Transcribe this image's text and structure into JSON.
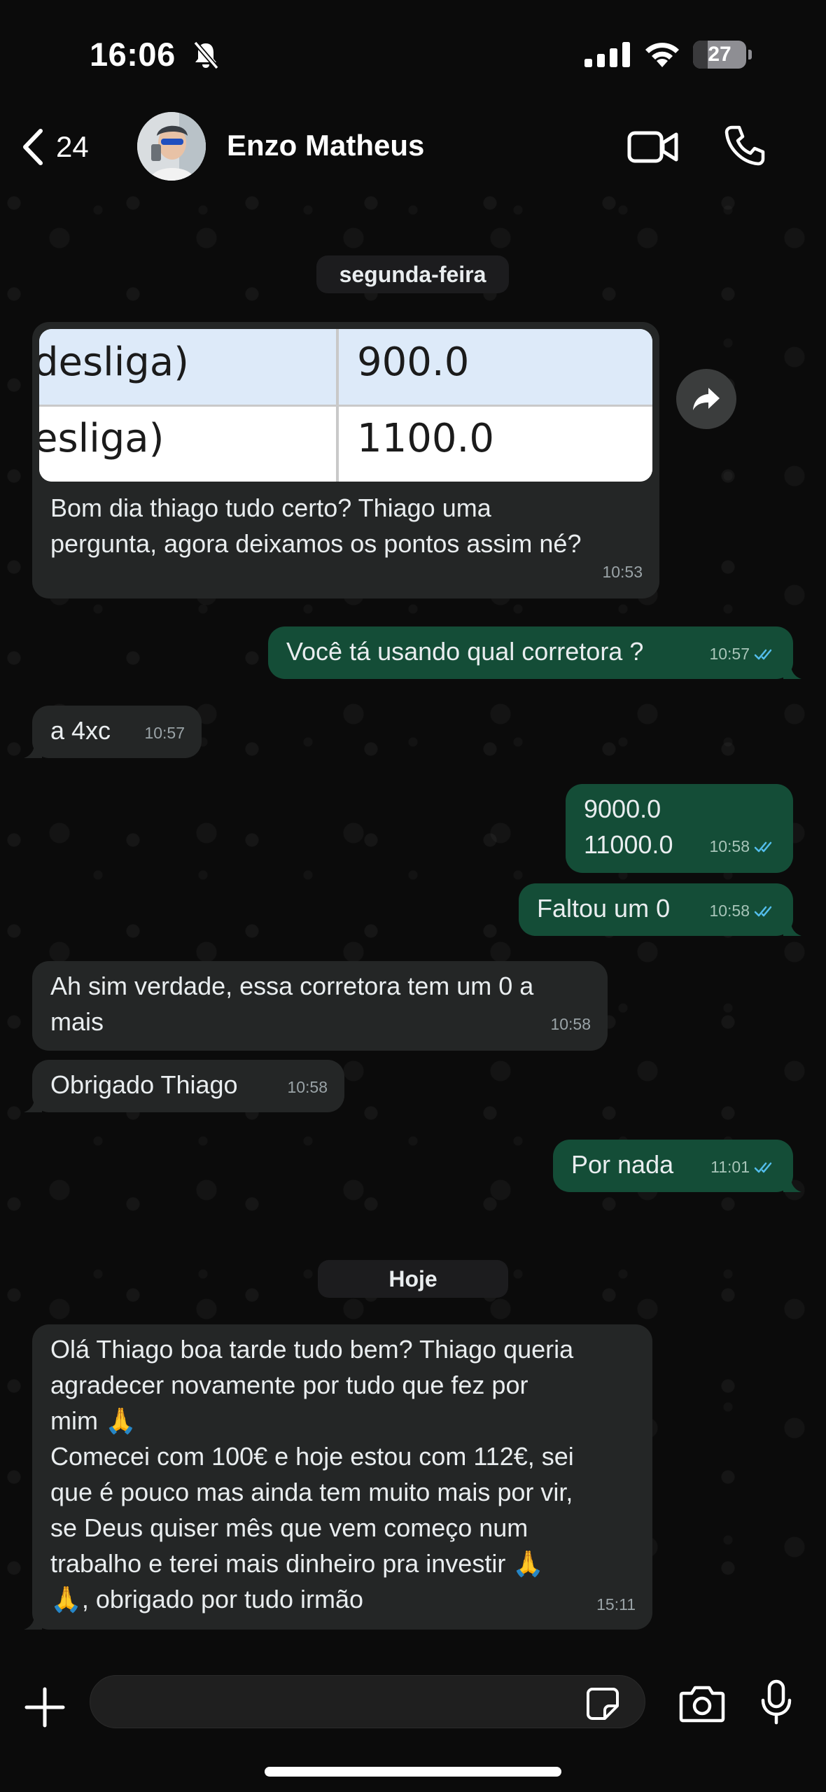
{
  "status_bar": {
    "time": "16:06",
    "battery": "27",
    "battery_level": 0.27
  },
  "header": {
    "back_count": "24",
    "contact_name": "Enzo Matheus"
  },
  "date_chips": {
    "monday": "segunda-feira",
    "today": "Hoje"
  },
  "table_image": {
    "rows": [
      {
        "left": "desliga)",
        "right": "900.0"
      },
      {
        "left": "esliga)",
        "right": "1100.0"
      }
    ]
  },
  "messages": [
    {
      "direction": "in",
      "text": "Bom dia thiago tudo certo? Thiago uma\npergunta, agora deixamos os pontos assim né?",
      "time": "10:53"
    },
    {
      "direction": "out",
      "text": "Você tá usando qual corretora ?",
      "time": "10:57"
    },
    {
      "direction": "in",
      "text": "a 4xc",
      "time": "10:57"
    },
    {
      "direction": "out",
      "text": "9000.0\n11000.0",
      "time": "10:58"
    },
    {
      "direction": "out",
      "text": "Faltou um 0",
      "time": "10:58"
    },
    {
      "direction": "in",
      "text": "Ah sim verdade, essa corretora tem um 0 a\nmais",
      "time": "10:58"
    },
    {
      "direction": "in",
      "text": "Obrigado Thiago",
      "time": "10:58"
    },
    {
      "direction": "out",
      "text": "Por nada",
      "time": "11:01"
    },
    {
      "direction": "in",
      "text": "Olá Thiago boa tarde tudo bem? Thiago queria\nagradecer novamente por tudo que fez por\nmim 🙏\nComecei com 100€ e hoje estou com 112€, sei\nque é pouco mas ainda tem muito mais por vir,\nse Deus quiser mês que vem começo num\ntrabalho e terei mais dinheiro pra investir 🙏\n🙏, obrigado por tudo irmão",
      "time": "15:11"
    }
  ],
  "colors": {
    "incoming": "#242626",
    "outgoing": "#144d37",
    "read_ticks": "#53bdeb",
    "background": "#0b0b0b"
  },
  "icons": [
    "bell-slash-icon",
    "signal-icon",
    "wifi-icon",
    "battery-icon",
    "back-chevron-icon",
    "video-camera-icon",
    "phone-icon",
    "forward-icon",
    "plus-icon",
    "sticker-icon",
    "camera-icon",
    "microphone-icon",
    "double-check-icon"
  ]
}
